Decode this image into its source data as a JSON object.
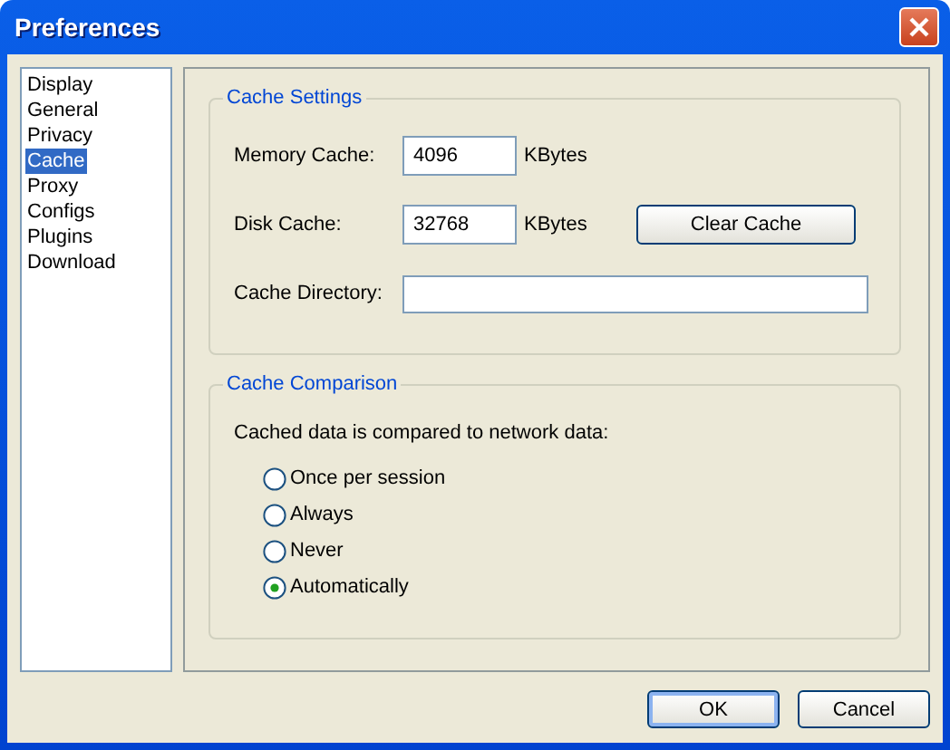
{
  "window": {
    "title": "Preferences"
  },
  "sidebar": {
    "items": [
      {
        "label": "Display",
        "selected": false
      },
      {
        "label": "General",
        "selected": false
      },
      {
        "label": "Privacy",
        "selected": false
      },
      {
        "label": "Cache",
        "selected": true
      },
      {
        "label": "Proxy",
        "selected": false
      },
      {
        "label": "Configs",
        "selected": false
      },
      {
        "label": "Plugins",
        "selected": false
      },
      {
        "label": "Download",
        "selected": false
      }
    ]
  },
  "cache_settings": {
    "title": "Cache Settings",
    "memory_cache": {
      "label": "Memory Cache:",
      "value": "4096",
      "unit": "KBytes"
    },
    "disk_cache": {
      "label": "Disk Cache:",
      "value": "32768",
      "unit": "KBytes"
    },
    "clear_button": "Clear Cache",
    "cache_directory": {
      "label": "Cache Directory:"
    }
  },
  "cache_comparison": {
    "title": "Cache Comparison",
    "prompt": "Cached data is compared to network data:",
    "options": [
      {
        "label": "Once per session",
        "selected": false
      },
      {
        "label": "Always",
        "selected": false
      },
      {
        "label": "Never",
        "selected": false
      },
      {
        "label": "Automatically",
        "selected": true
      }
    ]
  },
  "buttons": [
    {
      "label": "OK",
      "default": true
    },
    {
      "label": "Cancel",
      "default": false
    }
  ]
}
